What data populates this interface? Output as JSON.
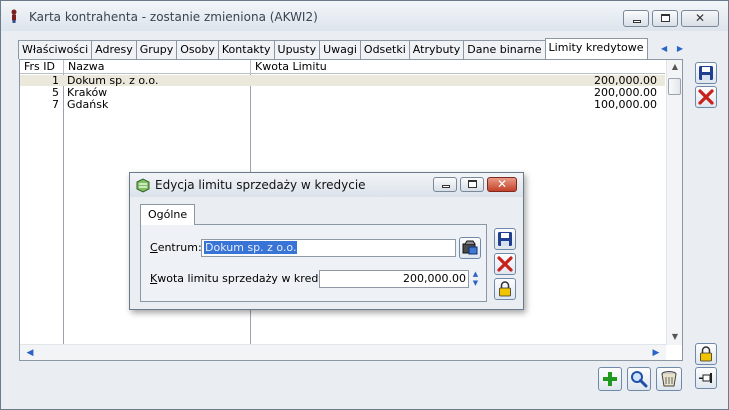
{
  "window": {
    "title": "Karta kontrahenta - zostanie zmieniona (AKWI2)"
  },
  "tabs": [
    "Właściwości",
    "Adresy",
    "Grupy",
    "Osoby",
    "Kontakty",
    "Upusty",
    "Uwagi",
    "Odsetki",
    "Atrybuty",
    "Dane binarne",
    "Limity kredytowe"
  ],
  "active_tab": "Limity kredytowe",
  "grid": {
    "columns": [
      "Frs ID",
      "Nazwa",
      "Kwota Limitu"
    ],
    "rows": [
      {
        "id": "1",
        "name": "Dokum sp. z o.o.",
        "amount": "200,000.00",
        "selected": true
      },
      {
        "id": "5",
        "name": "Kraków",
        "amount": "200,000.00",
        "selected": false
      },
      {
        "id": "7",
        "name": "Gdańsk",
        "amount": "100,000.00",
        "selected": false
      }
    ]
  },
  "side_buttons": {
    "save": "save-icon",
    "cancel": "cancel-icon",
    "lock": "lock-icon",
    "pin": "pin-icon"
  },
  "bottom_buttons": {
    "add": "add-icon",
    "search": "magnifier-icon",
    "delete": "trash-icon"
  },
  "dialog": {
    "title": "Edycja limitu sprzedaży w kredycie",
    "tab": "Ogólne",
    "centrum_label_hot": "C",
    "centrum_label_rest": "entrum:",
    "centrum_value": "Dokum sp. z o.o.",
    "kwota_label_hot": "K",
    "kwota_label_rest": "wota limitu sprzedaży w kredycie:",
    "kwota_value": "200,000.00"
  },
  "colors": {
    "accent": "#3873d6",
    "selected_row": "#ebe8dc",
    "close_red": "#c4412a"
  }
}
